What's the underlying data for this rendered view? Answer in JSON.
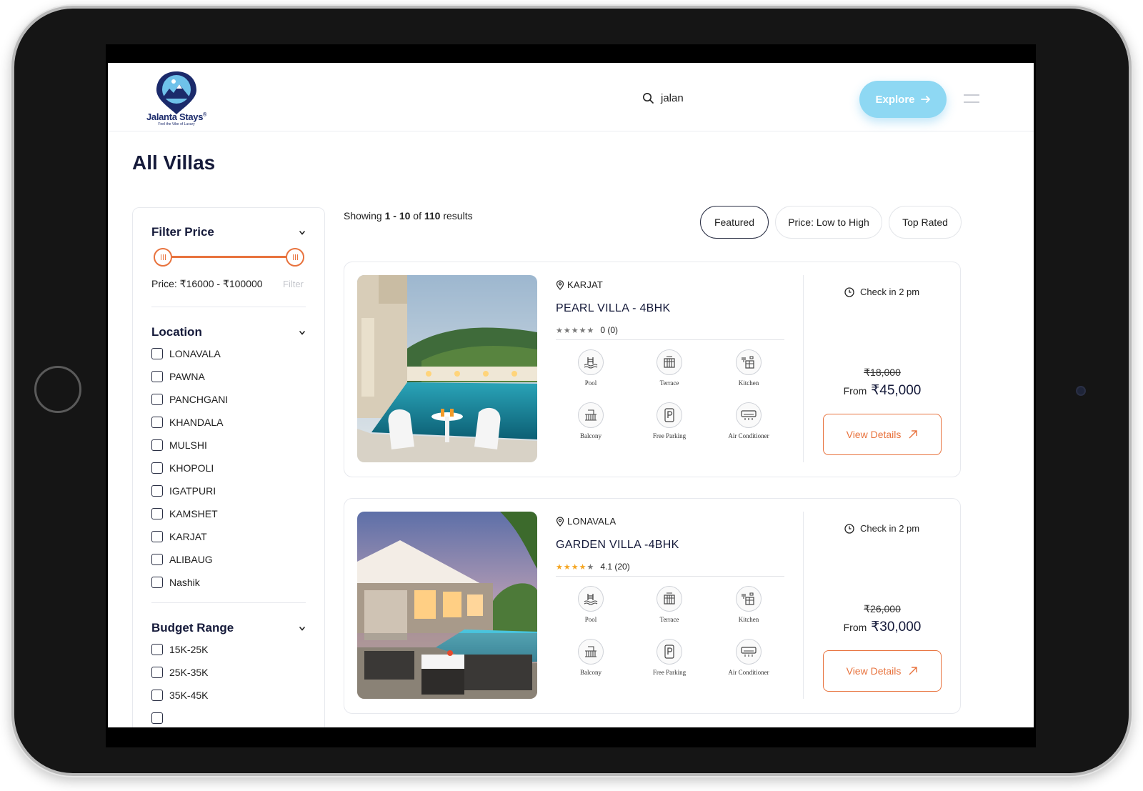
{
  "brand": {
    "name": "Jalanta Stays",
    "registered_mark": "®",
    "tagline": "Feel the Vibe of Luxury"
  },
  "header": {
    "search_value": "jalan",
    "explore_label": "Explore"
  },
  "page": {
    "title": "All Villas"
  },
  "filters": {
    "price": {
      "heading": "Filter Price",
      "range_text": "Price: ₹16000 - ₹100000",
      "filter_link": "Filter"
    },
    "location": {
      "heading": "Location",
      "options": [
        "LONAVALA",
        "PAWNA",
        "PANCHGANI",
        "KHANDALA",
        "MULSHI",
        "KHOPOLI",
        "IGATPURI",
        "KAMSHET",
        "KARJAT",
        "ALIBAUG",
        "Nashik"
      ]
    },
    "budget": {
      "heading": "Budget Range",
      "options": [
        "15K-25K",
        "25K-35K",
        "35K-45K"
      ]
    }
  },
  "results": {
    "prefix": "Showing",
    "range": "1 - 10",
    "of": "of",
    "total": "110",
    "suffix": "results"
  },
  "sort": {
    "options": [
      "Featured",
      "Price: Low to High",
      "Top Rated"
    ],
    "active": "Featured"
  },
  "villas": [
    {
      "location": "KARJAT",
      "name": "PEARL VILLA - 4BHK",
      "rating_text": "0 (0)",
      "stars_filled": 0,
      "amenities": [
        "Pool",
        "Terrace",
        "Kitchen",
        "Balcony",
        "Free Parking",
        "Air Conditioner"
      ],
      "checkin": "Check in 2 pm",
      "old_price": "₹18,000",
      "from_label": "From",
      "price": "₹45,000",
      "cta": "View Details"
    },
    {
      "location": "LONAVALA",
      "name": "GARDEN VILLA -4BHK",
      "rating_text": "4.1 (20)",
      "stars_filled": 4,
      "amenities": [
        "Pool",
        "Terrace",
        "Kitchen",
        "Balcony",
        "Free Parking",
        "Air Conditioner"
      ],
      "checkin": "Check in 2 pm",
      "old_price": "₹26,000",
      "from_label": "From",
      "price": "₹30,000",
      "cta": "View Details"
    }
  ],
  "colors": {
    "accent": "#e8733e",
    "explore_bg": "#8ed8f3",
    "heading": "#151a3a",
    "star_filled": "#f5a623",
    "star_empty": "#777777"
  },
  "icons": {
    "search": "search-icon",
    "explore_arrow": "arrow-right-icon",
    "menu": "menu-icon",
    "chevron": "chevron-down-icon",
    "location": "map-pin-icon",
    "clock": "clock-icon",
    "external": "arrow-up-right-icon"
  }
}
